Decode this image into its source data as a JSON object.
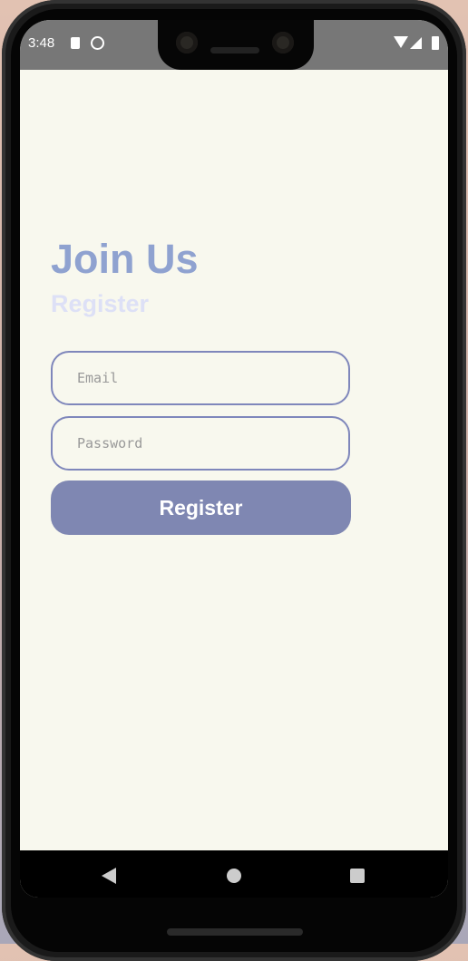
{
  "status_bar": {
    "time": "3:48",
    "icons": [
      "sd-card-icon",
      "sync-icon",
      "wifi-icon",
      "signal-icon",
      "battery-icon"
    ]
  },
  "main": {
    "title": "Join Us",
    "subtitle": "Register",
    "email_placeholder": "Email",
    "password_placeholder": "Password",
    "register_button": "Register"
  },
  "nav_bar": {
    "icons": [
      "back-icon",
      "home-icon",
      "recents-icon"
    ]
  },
  "colors": {
    "background": "#f8f8ee",
    "title": "#8fa2d0",
    "subtitle": "#dde0f6",
    "field_border": "#7f87bb",
    "button": "#7f87b2"
  }
}
